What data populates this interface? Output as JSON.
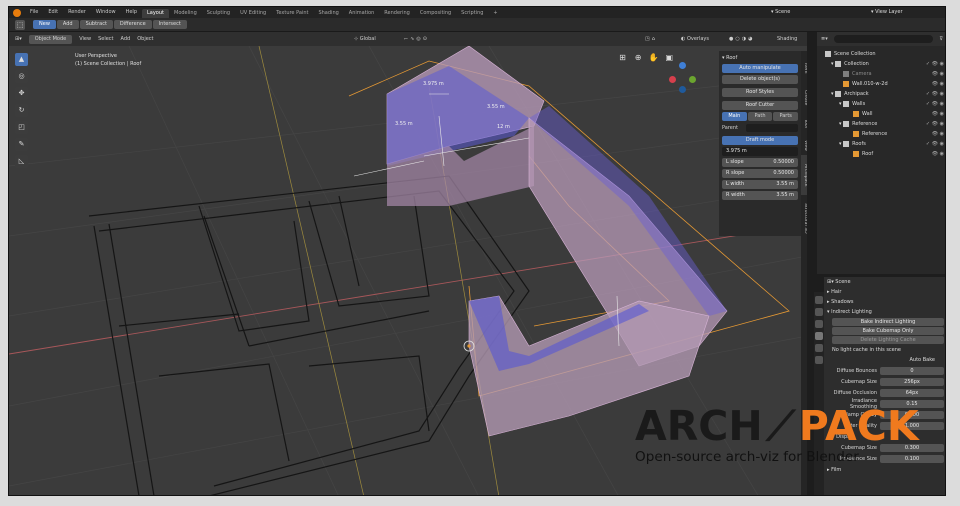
{
  "menubar": {
    "items": [
      "File",
      "Edit",
      "Render",
      "Window",
      "Help"
    ],
    "workspaces": [
      "Layout",
      "Modeling",
      "Sculpting",
      "UV Editing",
      "Texture Paint",
      "Shading",
      "Animation",
      "Rendering",
      "Compositing",
      "Scripting"
    ],
    "active_workspace": "Layout",
    "add_tab": "+",
    "scene": "Scene",
    "view_layer": "View Layer"
  },
  "tool_header": {
    "buttons": [
      "New",
      "Add",
      "Subtract",
      "Difference",
      "Intersect"
    ],
    "active": "New"
  },
  "viewport_header": {
    "mode": "Object Mode",
    "menus": [
      "View",
      "Select",
      "Add",
      "Object"
    ],
    "orientation": "Global",
    "overlays": "Overlays",
    "shading": "Shading"
  },
  "viewport": {
    "perspective": "User Perspective",
    "collection": "(1) Scene Collection | Roof",
    "dimensions": [
      "3.975 m",
      "3.55 m",
      "3.55 m",
      "12 m"
    ]
  },
  "npanel": {
    "title": "Roof",
    "auto_manipulate": "Auto manipulate",
    "delete_objects": "Delete object(s)",
    "roof_styles": "Roof Styles",
    "roof_cutter": "Roof Cutter",
    "tabs": [
      "Main",
      "Path",
      "Parts"
    ],
    "active_tab": "Main",
    "parent_label": "Parent",
    "draft_mode": "Draft mode",
    "height_field": "3.975 m",
    "fields": [
      {
        "label": "L slope",
        "value": "0.50000"
      },
      {
        "label": "R slope",
        "value": "0.50000"
      },
      {
        "label": "L width",
        "value": "3.55 m"
      },
      {
        "label": "R width",
        "value": "3.55 m"
      }
    ]
  },
  "vertical_tabs": [
    "Item",
    "Create",
    "Tool",
    "View",
    "Archipack",
    "Structural 3D"
  ],
  "outliner": {
    "root": "Scene Collection",
    "items": [
      {
        "name": "Collection",
        "level": 1
      },
      {
        "name": "Camera",
        "level": 2,
        "muted": true
      },
      {
        "name": "Wall.010-w-2d",
        "level": 2
      },
      {
        "name": "Archipack",
        "level": 1
      },
      {
        "name": "Walls",
        "level": 2
      },
      {
        "name": "Wall",
        "level": 3
      },
      {
        "name": "Reference",
        "level": 2
      },
      {
        "name": "Reference",
        "level": 3
      },
      {
        "name": "Roofs",
        "level": 2
      },
      {
        "name": "Roof",
        "level": 3
      }
    ]
  },
  "properties": {
    "scene": "Scene",
    "sections": [
      "Hair",
      "Shadows",
      "Indirect Lighting"
    ],
    "bake_indirect": "Bake Indirect Lighting",
    "bake_cubemap": "Bake Cubemap Only",
    "delete_cache": "Delete Lighting Cache",
    "no_cache": "No light cache in this scene",
    "auto_bake": "Auto Bake",
    "rows": [
      {
        "label": "Diffuse Bounces",
        "value": "0"
      },
      {
        "label": "Cubemap Size",
        "value": "256px"
      },
      {
        "label": "Diffuse Occlusion",
        "value": "64px"
      },
      {
        "label": "Irradiance Smoothing",
        "value": "0.15"
      },
      {
        "label": "Clamp Glossy",
        "value": "0.000"
      },
      {
        "label": "Filter Quality",
        "value": "1.000"
      }
    ],
    "display": "Display",
    "display_rows": [
      {
        "label": "Cubemap Size",
        "value": "0.300"
      },
      {
        "label": "Irradiance Size",
        "value": "0.100"
      }
    ],
    "film": "Film"
  },
  "watermark": {
    "logo_left": "ARCH",
    "logo_right": "PACK",
    "tagline": "Open-source arch-viz for Blender"
  }
}
